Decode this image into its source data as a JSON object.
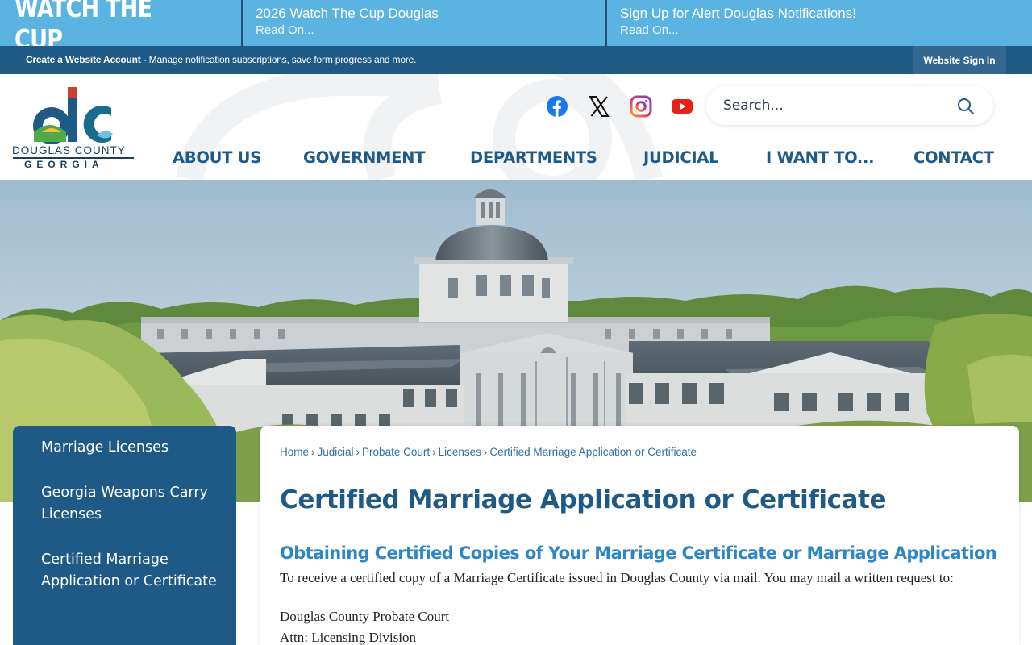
{
  "banner": {
    "brand": "WATCH THE CUP",
    "items": [
      {
        "title": "2026 Watch The Cup Douglas",
        "link": "Read On..."
      },
      {
        "title": "Sign Up for Alert Douglas Notifications!",
        "link": "Read On..."
      }
    ]
  },
  "account_bar": {
    "create_label": "Create a Website Account",
    "description": " - Manage notification subscriptions, save form progress and more.",
    "sign_in": "Website Sign In"
  },
  "logo": {
    "line1": "DOUGLAS COUNTY",
    "line2": "GEORGIA"
  },
  "social": [
    "facebook-icon",
    "x-icon",
    "instagram-icon",
    "youtube-icon"
  ],
  "search": {
    "placeholder": "Search..."
  },
  "nav": [
    "ABOUT US",
    "GOVERNMENT",
    "DEPARTMENTS",
    "JUDICIAL",
    "I WANT TO...",
    "CONTACT"
  ],
  "sidebar": {
    "items": [
      "Marriage Licenses",
      "Georgia Weapons Carry Licenses",
      "Certified Marriage Application or Certificate"
    ]
  },
  "breadcrumb": [
    "Home",
    "Judicial",
    "Probate Court",
    "Licenses",
    "Certified Marriage Application or Certificate"
  ],
  "page": {
    "title": "Certified Marriage Application or Certificate",
    "subtitle": "Obtaining Certified Copies of Your Marriage Certificate or Marriage Application",
    "paragraph": "To receive a certified copy of a Marriage Certificate issued in Douglas County via mail. You may mail a written request to:",
    "address_line1": "Douglas County Probate Court",
    "address_line2": "Attn: Licensing Division"
  },
  "colors": {
    "banner": "#5bb3e1",
    "navy": "#1f5a87",
    "link": "#2c6fa5",
    "subheading": "#2d86c6"
  }
}
